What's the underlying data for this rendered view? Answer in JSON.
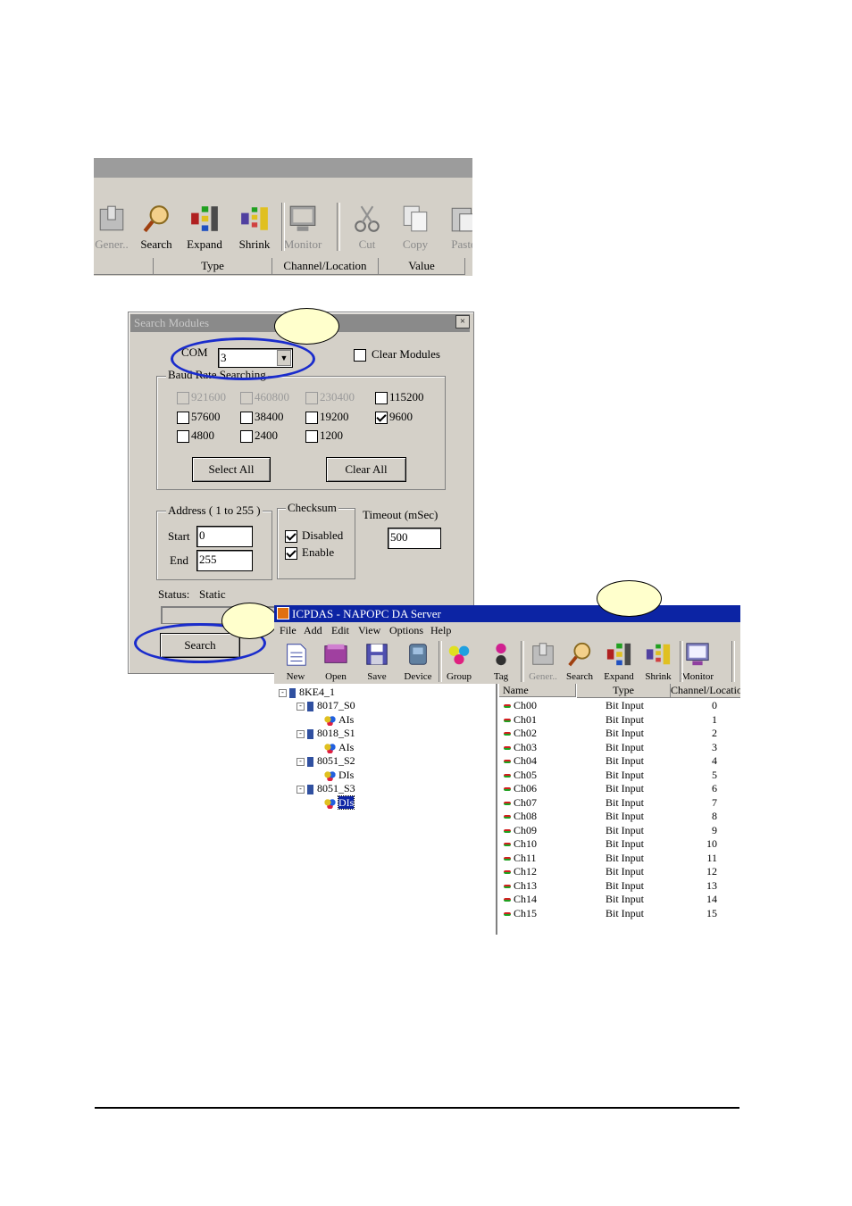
{
  "top_toolbar": {
    "buttons": [
      {
        "label": "Gener..",
        "icon": "tools-icon",
        "disabled": true
      },
      {
        "label": "Search",
        "icon": "magnifier-icon",
        "disabled": false
      },
      {
        "label": "Expand",
        "icon": "expand-icon",
        "disabled": false
      },
      {
        "label": "Shrink",
        "icon": "shrink-icon",
        "disabled": false
      },
      {
        "label": "Monitor",
        "icon": "monitor-icon",
        "disabled": true
      },
      {
        "label": "Cut",
        "icon": "scissors-icon",
        "disabled": true
      },
      {
        "label": "Copy",
        "icon": "copy-icon",
        "disabled": true
      },
      {
        "label": "Paste",
        "icon": "paste-icon",
        "disabled": true
      }
    ],
    "columns": [
      "",
      "Type",
      "Channel/Location",
      "Value"
    ]
  },
  "search_dialog": {
    "title": "Search Modules",
    "close": "×",
    "com_label": "COM",
    "com_value": "3",
    "clear_modules_label": "Clear Modules",
    "baud_group_label": "Baud Rate Searching",
    "baud_rates": [
      {
        "label": "921600",
        "checked": false,
        "disabled": true
      },
      {
        "label": "460800",
        "checked": false,
        "disabled": true
      },
      {
        "label": "230400",
        "checked": false,
        "disabled": true
      },
      {
        "label": "115200",
        "checked": false,
        "disabled": false
      },
      {
        "label": "57600",
        "checked": false,
        "disabled": false
      },
      {
        "label": "38400",
        "checked": false,
        "disabled": false
      },
      {
        "label": "19200",
        "checked": false,
        "disabled": false
      },
      {
        "label": "9600",
        "checked": true,
        "disabled": false
      },
      {
        "label": "4800",
        "checked": false,
        "disabled": false
      },
      {
        "label": "2400",
        "checked": false,
        "disabled": false
      },
      {
        "label": "1200",
        "checked": false,
        "disabled": false
      }
    ],
    "select_all": "Select All",
    "clear_all": "Clear All",
    "address_group_label": "Address ( 1 to 255 )",
    "start_label": "Start",
    "start_value": "0",
    "end_label": "End",
    "end_value": "255",
    "checksum_group_label": "Checksum",
    "checksum_disabled": "Disabled",
    "checksum_enable": "Enable",
    "timeout_label": "Timeout (mSec)",
    "timeout_value": "500",
    "status_label": "Status:",
    "status_value": "Static",
    "search_button": "Search"
  },
  "napopc": {
    "title": "ICPDAS - NAPOPC DA Server",
    "menu": [
      "File",
      "Add",
      "Edit",
      "View",
      "Options",
      "Help"
    ],
    "toolbar": [
      {
        "label": "New",
        "icon": "new-icon",
        "disabled": false
      },
      {
        "label": "Open",
        "icon": "open-icon",
        "disabled": false
      },
      {
        "label": "Save",
        "icon": "save-icon",
        "disabled": false
      },
      {
        "label": "Device",
        "icon": "device-icon",
        "disabled": false
      },
      {
        "label": "Group",
        "icon": "group-icon",
        "disabled": false
      },
      {
        "label": "Tag",
        "icon": "tag-icon",
        "disabled": false
      },
      {
        "label": "Gener..",
        "icon": "tools-icon",
        "disabled": true
      },
      {
        "label": "Search",
        "icon": "magnifier-icon",
        "disabled": false
      },
      {
        "label": "Expand",
        "icon": "expand-icon",
        "disabled": false
      },
      {
        "label": "Shrink",
        "icon": "shrink-icon",
        "disabled": false
      },
      {
        "label": "Monitor",
        "icon": "monitor-icon",
        "disabled": false
      }
    ],
    "tree": {
      "root": "8KE4_1",
      "modules": [
        {
          "name": "8017_S0",
          "group": "AIs",
          "selected": false
        },
        {
          "name": "8018_S1",
          "group": "AIs",
          "selected": false
        },
        {
          "name": "8051_S2",
          "group": "DIs",
          "selected": false
        },
        {
          "name": "8051_S3",
          "group": "DIs",
          "selected": true
        }
      ]
    },
    "list": {
      "columns": [
        "Name",
        "Type",
        "Channel/Locatio"
      ],
      "rows": [
        {
          "name": "Ch00",
          "type": "Bit Input",
          "ch": "0"
        },
        {
          "name": "Ch01",
          "type": "Bit Input",
          "ch": "1"
        },
        {
          "name": "Ch02",
          "type": "Bit Input",
          "ch": "2"
        },
        {
          "name": "Ch03",
          "type": "Bit Input",
          "ch": "3"
        },
        {
          "name": "Ch04",
          "type": "Bit Input",
          "ch": "4"
        },
        {
          "name": "Ch05",
          "type": "Bit Input",
          "ch": "5"
        },
        {
          "name": "Ch06",
          "type": "Bit Input",
          "ch": "6"
        },
        {
          "name": "Ch07",
          "type": "Bit Input",
          "ch": "7"
        },
        {
          "name": "Ch08",
          "type": "Bit Input",
          "ch": "8"
        },
        {
          "name": "Ch09",
          "type": "Bit Input",
          "ch": "9"
        },
        {
          "name": "Ch10",
          "type": "Bit Input",
          "ch": "10"
        },
        {
          "name": "Ch11",
          "type": "Bit Input",
          "ch": "11"
        },
        {
          "name": "Ch12",
          "type": "Bit Input",
          "ch": "12"
        },
        {
          "name": "Ch13",
          "type": "Bit Input",
          "ch": "13"
        },
        {
          "name": "Ch14",
          "type": "Bit Input",
          "ch": "14"
        },
        {
          "name": "Ch15",
          "type": "Bit Input",
          "ch": "15"
        }
      ]
    }
  },
  "colors": {
    "highlight_ellipse": "#1a2ccc",
    "callout_bubble": "#ffffcc",
    "titlebar_active": "#0c24a4",
    "dialog_bg": "#d4d0c8"
  }
}
